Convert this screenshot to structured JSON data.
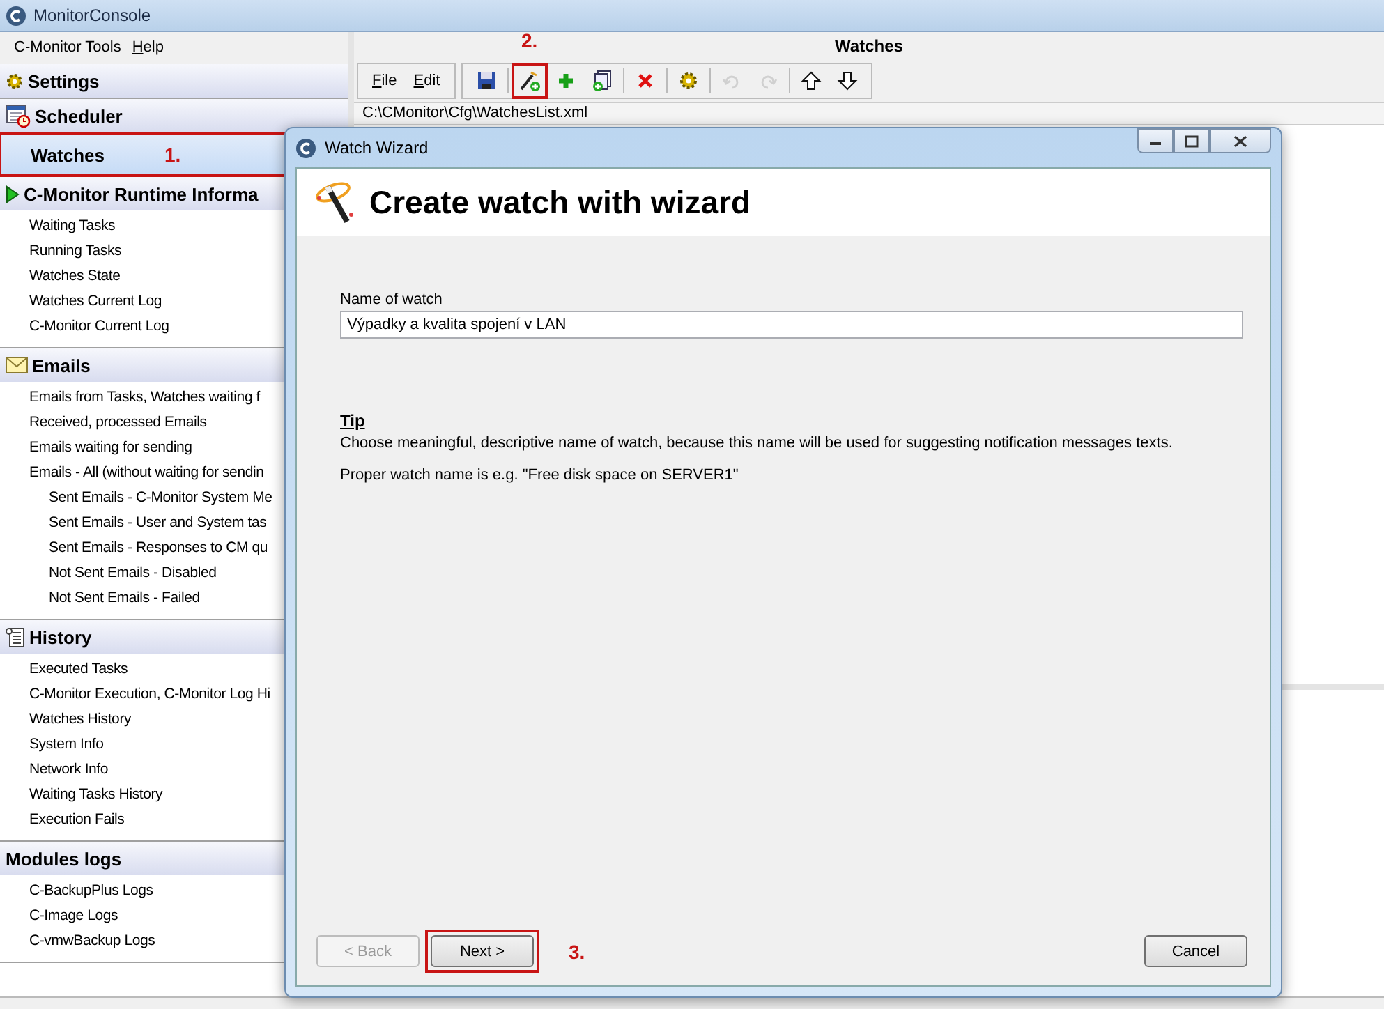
{
  "window": {
    "title": "MonitorConsole"
  },
  "menu": [
    {
      "label": "C-Monitor Tools",
      "underlined_first": false
    },
    {
      "label": "Help",
      "underlined_first": true
    }
  ],
  "sidebar": {
    "sections": [
      {
        "title": "Settings",
        "selected": false,
        "highlighted": false
      },
      {
        "title": "Scheduler",
        "selected": false,
        "highlighted": false
      },
      {
        "title": "Watches",
        "selected": true,
        "highlighted": true,
        "annotation": "1."
      },
      {
        "title": "C-Monitor Runtime Informa",
        "selected": false,
        "highlighted": false,
        "items": [
          {
            "label": "Waiting Tasks"
          },
          {
            "label": "Running Tasks"
          },
          {
            "label": "Watches State"
          },
          {
            "label": "Watches Current Log"
          },
          {
            "label": "C-Monitor Current Log"
          }
        ]
      },
      {
        "title": "Emails",
        "selected": false,
        "highlighted": false,
        "items": [
          {
            "label": "Emails from Tasks, Watches waiting f"
          },
          {
            "label": "Received, processed Emails"
          },
          {
            "label": "Emails waiting for sending"
          },
          {
            "label": "Emails - All (without waiting for sendin",
            "children": [
              {
                "label": "Sent Emails - C-Monitor System Me"
              },
              {
                "label": "Sent Emails - User and System tas"
              },
              {
                "label": "Sent Emails - Responses to CM qu"
              },
              {
                "label": "Not Sent Emails - Disabled"
              },
              {
                "label": "Not Sent Emails - Failed"
              }
            ]
          }
        ]
      },
      {
        "title": "History",
        "selected": false,
        "highlighted": false,
        "items": [
          {
            "label": "Executed Tasks"
          },
          {
            "label": "C-Monitor Execution, C-Monitor Log Hi"
          },
          {
            "label": "Watches History"
          },
          {
            "label": "System Info"
          },
          {
            "label": "Network Info"
          },
          {
            "label": "Waiting Tasks History"
          },
          {
            "label": "Execution Fails"
          }
        ]
      },
      {
        "title": "Modules logs",
        "selected": false,
        "highlighted": false,
        "items": [
          {
            "label": "C-BackupPlus Logs"
          },
          {
            "label": "C-Image Logs"
          },
          {
            "label": "C-vmwBackup Logs"
          }
        ]
      }
    ]
  },
  "main": {
    "title": "Watches",
    "menu": [
      {
        "label": "File",
        "underlined_first": true
      },
      {
        "label": "Edit",
        "underlined_first": true
      }
    ],
    "toolbar": [
      {
        "disabled": false,
        "highlighted": false
      },
      {
        "disabled": false,
        "highlighted": true,
        "annotation": "2."
      },
      {
        "disabled": false,
        "highlighted": false
      },
      {
        "disabled": false,
        "highlighted": false
      },
      {
        "disabled": false,
        "highlighted": false
      },
      {
        "disabled": false,
        "highlighted": false
      },
      {
        "disabled": true,
        "highlighted": false
      },
      {
        "disabled": true,
        "highlighted": false
      },
      {
        "disabled": false,
        "highlighted": false
      },
      {
        "disabled": false,
        "highlighted": false
      }
    ],
    "path": "C:\\CMonitor\\Cfg\\WatchesList.xml"
  },
  "dialog": {
    "title": "Watch Wizard",
    "heading": "Create watch with wizard",
    "field": {
      "label": "Name of watch",
      "value": "Výpadky a kvalita spojení v LAN"
    },
    "tip_title": "Tip",
    "tip_text": "Choose meaningful, descriptive name of watch, because this name will be used for suggesting notification messages texts.",
    "example": "Proper watch name is e.g. \"Free disk space on SERVER1\"",
    "buttons": [
      {
        "label": "< Back",
        "disabled": true,
        "highlighted": false
      },
      {
        "label": "Next >",
        "disabled": false,
        "highlighted": true,
        "annotation": "3."
      },
      {
        "label": "Cancel",
        "disabled": false,
        "highlighted": false
      }
    ]
  }
}
